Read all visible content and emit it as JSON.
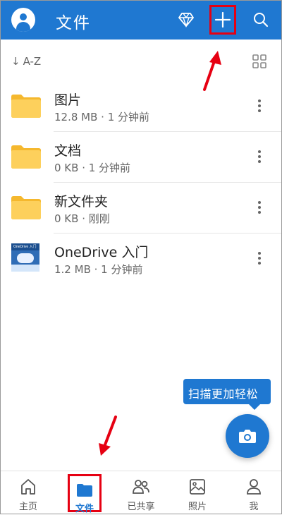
{
  "header": {
    "title": "文件",
    "bg_color": "#1f78d1",
    "icons": [
      "avatar",
      "premium-diamond-icon",
      "add-icon",
      "search-icon"
    ]
  },
  "sort": {
    "arrow": "↓",
    "label": "A-Z"
  },
  "files": [
    {
      "name": "图片",
      "meta": "12.8 MB · 1 分钟前",
      "type": "folder"
    },
    {
      "name": "文档",
      "meta": "0 KB · 1 分钟前",
      "type": "folder"
    },
    {
      "name": "新文件夹",
      "meta": "0 KB · 刚刚",
      "type": "folder"
    },
    {
      "name": "OneDrive 入门",
      "meta": "1.2 MB · 1 分钟前",
      "type": "pdf",
      "thumb_text": "OneDrive 入门"
    }
  ],
  "scan_tooltip": "扫描更加轻松",
  "nav": {
    "home": "主页",
    "files": "文件",
    "shared": "已共享",
    "photos": "照片",
    "me": "我"
  },
  "colors": {
    "accent": "#1f78d1",
    "folder": "#f9c54c",
    "highlight": "#e60012"
  }
}
